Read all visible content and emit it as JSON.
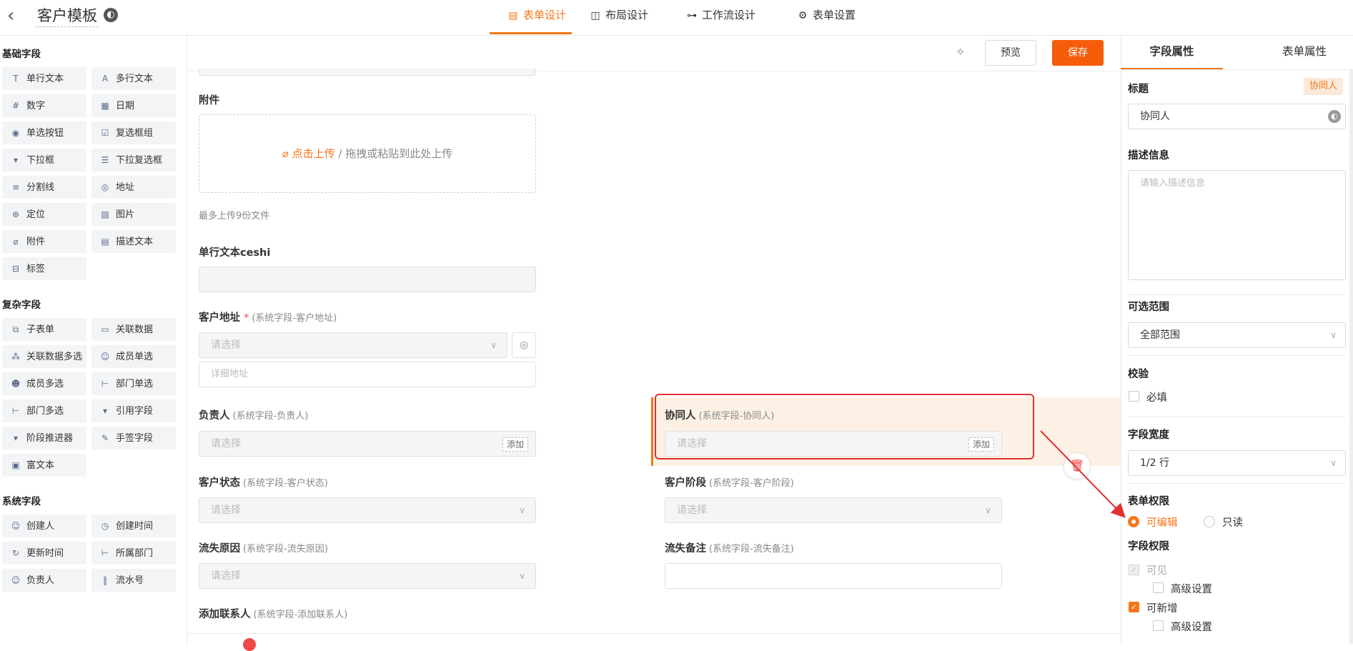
{
  "header": {
    "back_icon": "chevron-left-icon",
    "title": "客户模板",
    "tabs": [
      {
        "label": "表单设计",
        "icon": "form-icon",
        "active": true
      },
      {
        "label": "布局设计",
        "icon": "layout-icon",
        "active": false
      },
      {
        "label": "工作流设计",
        "icon": "workflow-icon",
        "active": false
      },
      {
        "label": "表单设置",
        "icon": "gear-icon",
        "active": false
      }
    ]
  },
  "sidebar": {
    "basic_title": "基础字段",
    "basic": [
      "单行文本",
      "多行文本",
      "数字",
      "日期",
      "单选按钮",
      "复选框组",
      "下拉框",
      "下拉复选框",
      "分割线",
      "地址",
      "定位",
      "图片",
      "附件",
      "描述文本",
      "标签"
    ],
    "complex_title": "复杂字段",
    "complex": [
      "子表单",
      "关联数据",
      "关联数据多选",
      "成员单选",
      "成员多选",
      "部门单选",
      "部门多选",
      "引用字段",
      "阶段推进器",
      "手签字段",
      "富文本"
    ],
    "system_title": "系统字段",
    "system": [
      "创建人",
      "创建时间",
      "更新时间",
      "所属部门",
      "负责人",
      "流水号"
    ]
  },
  "toolbar": {
    "preview": "预览",
    "save": "保存"
  },
  "form": {
    "attachment": {
      "label": "附件",
      "upload_link": "点击上传",
      "upload_text": " / 拖拽或粘贴到此处上传",
      "hint": "最多上传9份文件"
    },
    "single_text": {
      "label": "单行文本ceshi"
    },
    "address": {
      "label": "客户地址",
      "required_mark": "*",
      "sub": "(系统字段-客户地址)",
      "placeholder": "请选择",
      "detail_placeholder": "详细地址"
    },
    "owner": {
      "label": "负责人",
      "sub": "(系统字段-负责人)",
      "placeholder": "请选择",
      "add": "添加"
    },
    "collaborator": {
      "label": "协同人",
      "sub": "(系统字段-协同人)",
      "placeholder": "请选择",
      "add": "添加"
    },
    "status": {
      "label": "客户状态",
      "sub": "(系统字段-客户状态)",
      "placeholder": "请选择"
    },
    "stage": {
      "label": "客户阶段",
      "sub": "(系统字段-客户阶段)",
      "placeholder": "请选择"
    },
    "lost_reason": {
      "label": "流失原因",
      "sub": "(系统字段-流失原因)",
      "placeholder": "请选择"
    },
    "lost_note": {
      "label": "流失备注",
      "sub": "(系统字段-流失备注)"
    },
    "add_contact": {
      "label": "添加联系人",
      "sub": "(系统字段-添加联系人)"
    }
  },
  "props": {
    "tabs": [
      "字段属性",
      "表单属性"
    ],
    "title_label": "标题",
    "title_badge": "协同人",
    "title_value": "协同人",
    "desc_label": "描述信息",
    "desc_placeholder": "请输入描述信息",
    "range_label": "可选范围",
    "range_value": "全部范围",
    "validate_label": "校验",
    "required": "必填",
    "width_label": "字段宽度",
    "width_value": "1/2 行",
    "form_perm_label": "表单权限",
    "editable": "可编辑",
    "readonly": "只读",
    "field_perm_label": "字段权限",
    "visible": "可见",
    "advanced": "高级设置",
    "can_add": "可新增",
    "advanced2": "高级设置"
  },
  "colors": {
    "accent": "#f5761a",
    "save": "#f55d0a",
    "annotation": "#e03030"
  }
}
